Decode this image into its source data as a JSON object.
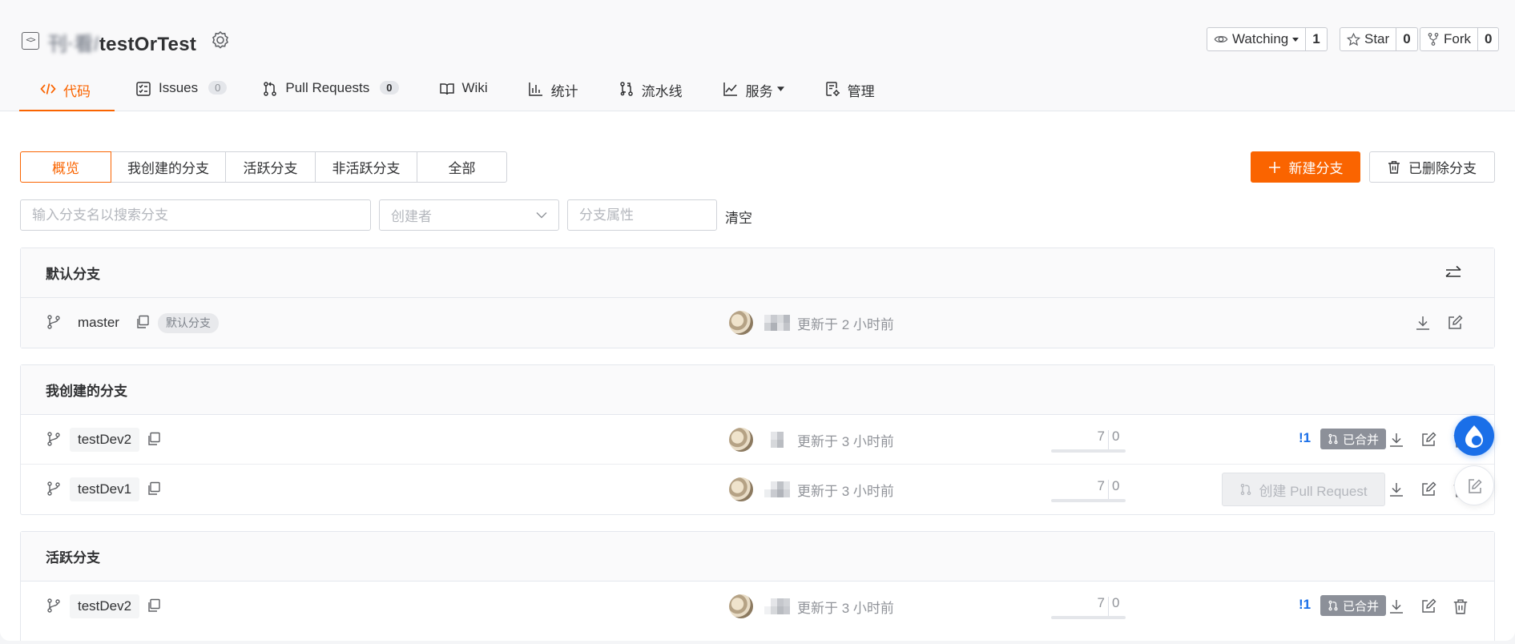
{
  "repo": {
    "title_blurred": "刊·看/",
    "title_visible": "testOrTest"
  },
  "header_buttons": {
    "watch": {
      "label": "Watching",
      "count": "1"
    },
    "star": {
      "label": "Star",
      "count": "0"
    },
    "fork": {
      "label": "Fork",
      "count": "0"
    }
  },
  "nav": [
    {
      "label": "代码",
      "count": null,
      "icon": "code-icon"
    },
    {
      "label": "Issues",
      "count": "0",
      "icon": "issues-icon"
    },
    {
      "label": "Pull Requests",
      "count": "0",
      "icon": "pull-request-icon"
    },
    {
      "label": "Wiki",
      "count": null,
      "icon": "book-icon"
    },
    {
      "label": "统计",
      "count": null,
      "icon": "bar-chart-icon"
    },
    {
      "label": "流水线",
      "count": null,
      "icon": "pipeline-icon"
    },
    {
      "label": "服务",
      "count": null,
      "icon": "line-chart-icon"
    },
    {
      "label": "管理",
      "count": null,
      "icon": "settings-doc-icon"
    }
  ],
  "tabs": [
    "概览",
    "我创建的分支",
    "活跃分支",
    "非活跃分支",
    "全部"
  ],
  "actions": {
    "new_branch": "新建分支",
    "deleted_branches": "已删除分支"
  },
  "filters": {
    "search_placeholder": "输入分支名以搜索分支",
    "creator_placeholder": "创建者",
    "attr_placeholder": "分支属性",
    "clear": "清空"
  },
  "sections": {
    "default": {
      "title": "默认分支",
      "branch": "master",
      "tag": "默认分支",
      "updated": "更新于 2 小时前"
    },
    "mine": {
      "title": "我创建的分支",
      "rows": [
        {
          "branch": "testDev2",
          "updated": "更新于 3 小时前",
          "ahead": "7",
          "behind": "0",
          "mr": "!1",
          "status": "已合并"
        },
        {
          "branch": "testDev1",
          "updated": "更新于 3 小时前",
          "ahead": "7",
          "behind": "0",
          "create_pr": "创建 Pull Request"
        }
      ]
    },
    "active": {
      "title": "活跃分支",
      "rows": [
        {
          "branch": "testDev2",
          "updated": "更新于 3 小时前",
          "ahead": "7",
          "behind": "0",
          "mr": "!1",
          "status": "已合并"
        }
      ]
    }
  }
}
